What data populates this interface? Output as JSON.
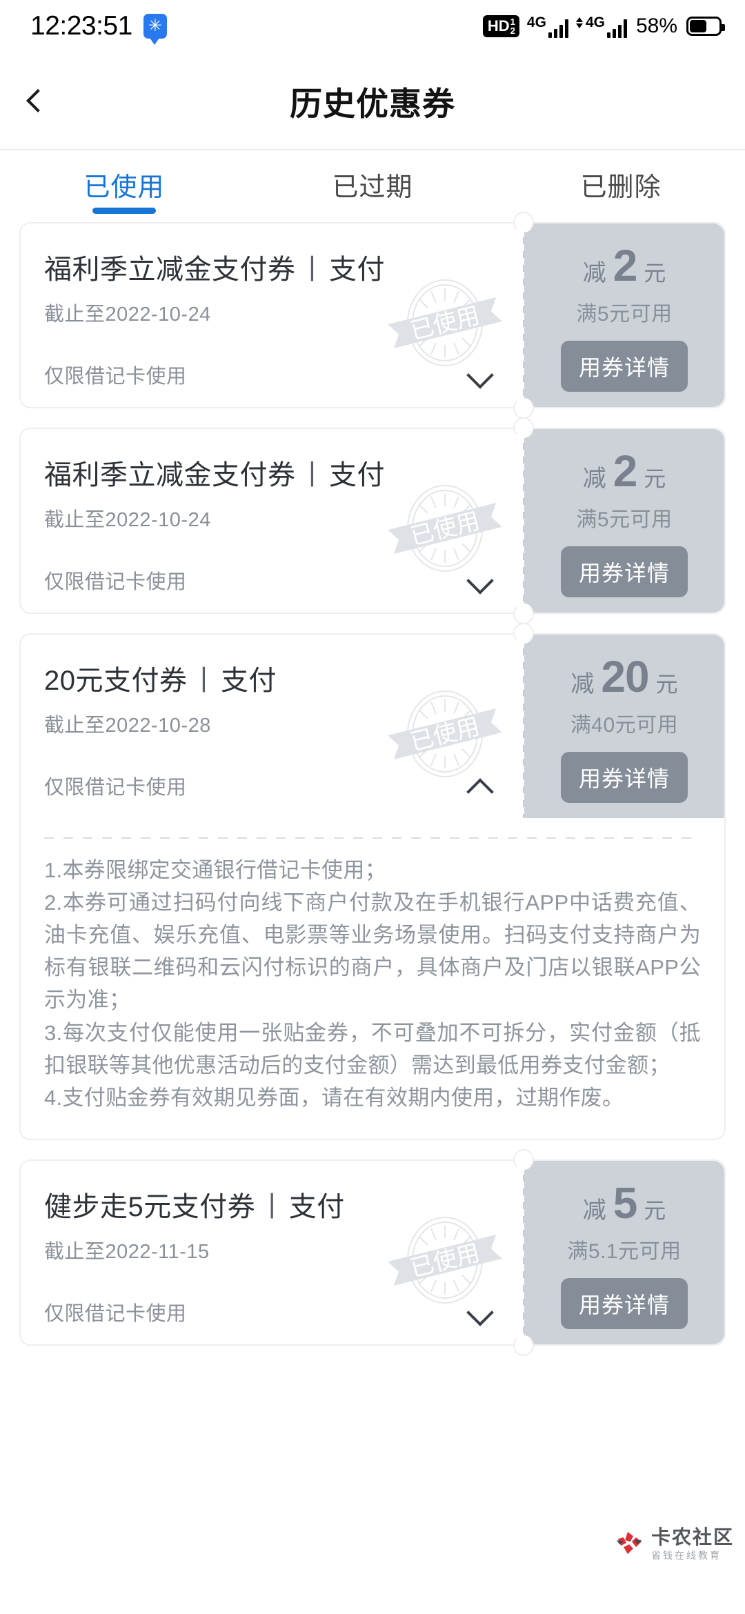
{
  "status_bar": {
    "time": "12:23:51",
    "bubble_icon": "message-bubble-icon",
    "hd_label": "HD",
    "hd_sup": "1",
    "hd_sub": "2",
    "net1": "4G",
    "net2": "4G",
    "battery_percent": "58%"
  },
  "nav": {
    "back_icon": "chevron-left-icon",
    "title": "历史优惠券"
  },
  "tabs": [
    {
      "label": "已使用",
      "active": true
    },
    {
      "label": "已过期",
      "active": false
    },
    {
      "label": "已删除",
      "active": false
    }
  ],
  "stamp_text": "已使用",
  "coupons": [
    {
      "title": "福利季立减金支付券",
      "channel": "支付",
      "date": "截止至2022-10-24",
      "limit": "仅限借记卡使用",
      "amount_prefix": "减",
      "amount": "2",
      "amount_unit": "元",
      "condition": "满5元可用",
      "button": "用券详情",
      "expanded": false,
      "chevron": "chevron-down-icon"
    },
    {
      "title": "福利季立减金支付券",
      "channel": "支付",
      "date": "截止至2022-10-24",
      "limit": "仅限借记卡使用",
      "amount_prefix": "减",
      "amount": "2",
      "amount_unit": "元",
      "condition": "满5元可用",
      "button": "用券详情",
      "expanded": false,
      "chevron": "chevron-down-icon"
    },
    {
      "title": "20元支付券",
      "channel": "支付",
      "date": "截止至2022-10-28",
      "limit": "仅限借记卡使用",
      "amount_prefix": "减",
      "amount": "20",
      "amount_unit": "元",
      "condition": "满40元可用",
      "button": "用券详情",
      "expanded": true,
      "chevron": "chevron-up-icon",
      "terms": "1.本券限绑定交通银行借记卡使用；\n2.本券可通过扫码付向线下商户付款及在手机银行APP中话费充值、油卡充值、娱乐充值、电影票等业务场景使用。扫码支付支持商户为标有银联二维码和云闪付标识的商户，具体商户及门店以银联APP公示为准；\n3.每次支付仅能使用一张贴金券，不可叠加不可拆分，实付金额（抵扣银联等其他优惠活动后的支付金额）需达到最低用券支付金额；\n4.支付贴金券有效期见券面，请在有效期内使用，过期作废。"
    },
    {
      "title": "健步走5元支付券",
      "channel": "支付",
      "date": "截止至2022-11-15",
      "limit": "仅限借记卡使用",
      "amount_prefix": "减",
      "amount": "5",
      "amount_unit": "元",
      "condition": "满5.1元可用",
      "button": "用券详情",
      "expanded": false,
      "chevron": "chevron-down-icon"
    }
  ],
  "watermark": {
    "name": "卡农社区",
    "slogan": "省钱在线教育"
  },
  "colors": {
    "accent": "#1575d6",
    "amount_panel": "#cdd2d9",
    "button": "#858d98"
  }
}
